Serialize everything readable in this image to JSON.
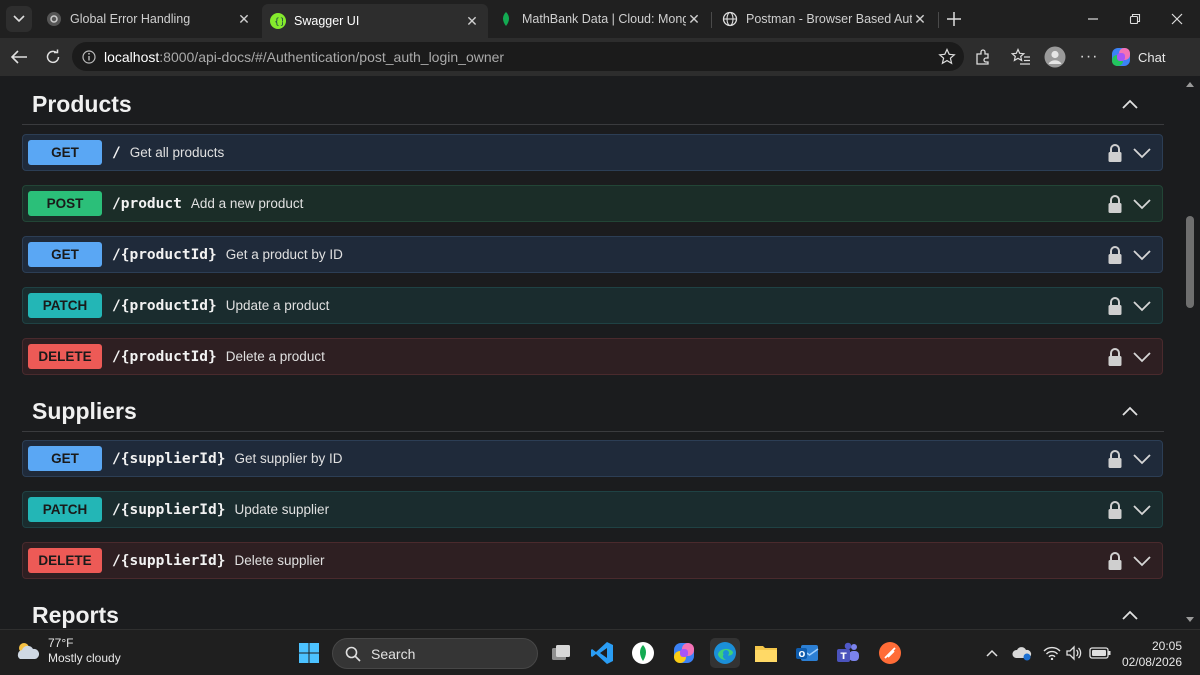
{
  "browser": {
    "tabs": [
      {
        "label": "Global Error Handling",
        "icon": "gear-favicon"
      },
      {
        "label": "Swagger UI",
        "icon": "swagger-favicon",
        "active": true
      },
      {
        "label": "MathBank Data | Cloud: MongoDB",
        "icon": "mongodb-leaf-favicon"
      },
      {
        "label": "Postman - Browser Based Auth",
        "icon": "globe-favicon"
      }
    ],
    "url_host": "localhost",
    "url_rest": ":8000/api-docs/#/Authentication/post_auth_login_owner",
    "chat_label": "Chat"
  },
  "sections": [
    {
      "title": "Products",
      "operations": [
        {
          "method": "GET",
          "path": "/",
          "summary": "Get all products"
        },
        {
          "method": "POST",
          "path": "/product",
          "summary": "Add a new product"
        },
        {
          "method": "GET",
          "path": "/{productId}",
          "summary": "Get a product by ID"
        },
        {
          "method": "PATCH",
          "path": "/{productId}",
          "summary": "Update a product"
        },
        {
          "method": "DELETE",
          "path": "/{productId}",
          "summary": "Delete a product"
        }
      ]
    },
    {
      "title": "Suppliers",
      "operations": [
        {
          "method": "GET",
          "path": "/{supplierId}",
          "summary": "Get supplier by ID"
        },
        {
          "method": "PATCH",
          "path": "/{supplierId}",
          "summary": "Update supplier"
        },
        {
          "method": "DELETE",
          "path": "/{supplierId}",
          "summary": "Delete supplier"
        }
      ]
    },
    {
      "title": "Reports",
      "operations": []
    }
  ],
  "taskbar": {
    "weather_temp": "77°F",
    "weather_desc": "Mostly cloudy",
    "search_label": "Search",
    "time": "20:05",
    "date": "02/08/2026"
  },
  "colors": {
    "get": "#5aa7f4",
    "post": "#2bbf79",
    "patch": "#23b6b6",
    "delete": "#ed5a56"
  }
}
